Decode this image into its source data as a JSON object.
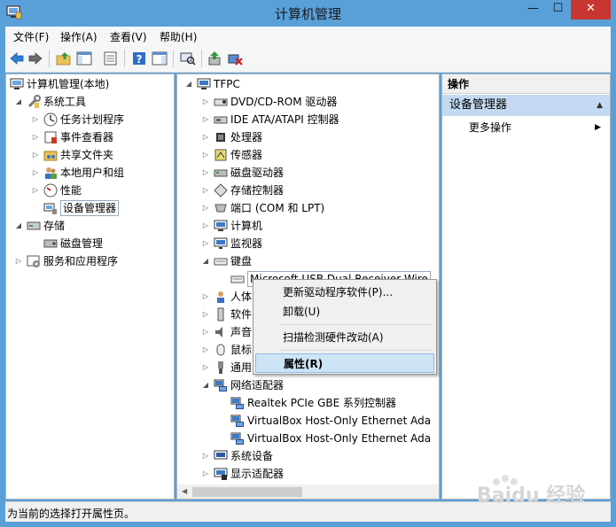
{
  "window": {
    "title": "计算机管理"
  },
  "titlebar_buttons": {
    "minimize": "—",
    "maximize": "☐",
    "close": "✕"
  },
  "menu": [
    {
      "label": "文件(F)"
    },
    {
      "label": "操作(A)"
    },
    {
      "label": "查看(V)"
    },
    {
      "label": "帮助(H)"
    }
  ],
  "toolbar": {
    "icons": [
      "back-icon",
      "forward-icon",
      "up-folder-icon",
      "show-hide-tree-icon",
      "properties-icon",
      "help-icon",
      "show-hide-action-pane-icon",
      "scan-hardware-icon",
      "update-driver-icon",
      "uninstall-device-icon"
    ]
  },
  "left_tree": [
    {
      "label": "计算机管理(本地)",
      "icon": "computer-management-icon",
      "level": 0,
      "arrow": ""
    },
    {
      "label": "系统工具",
      "icon": "system-tools-icon",
      "level": 1,
      "arrow": "expanded"
    },
    {
      "label": "任务计划程序",
      "icon": "task-scheduler-icon",
      "level": 2,
      "arrow": "collapsed"
    },
    {
      "label": "事件查看器",
      "icon": "event-viewer-icon",
      "level": 2,
      "arrow": "collapsed"
    },
    {
      "label": "共享文件夹",
      "icon": "shared-folders-icon",
      "level": 2,
      "arrow": "collapsed"
    },
    {
      "label": "本地用户和组",
      "icon": "local-users-icon",
      "level": 2,
      "arrow": "collapsed"
    },
    {
      "label": "性能",
      "icon": "performance-icon",
      "level": 2,
      "arrow": "collapsed"
    },
    {
      "label": "设备管理器",
      "icon": "device-manager-icon",
      "level": 2,
      "arrow": "",
      "selected": true
    },
    {
      "label": "存储",
      "icon": "storage-icon",
      "level": 1,
      "arrow": "expanded"
    },
    {
      "label": "磁盘管理",
      "icon": "disk-management-icon",
      "level": 2,
      "arrow": ""
    },
    {
      "label": "服务和应用程序",
      "icon": "services-icon",
      "level": 1,
      "arrow": "collapsed"
    }
  ],
  "device_tree": [
    {
      "label": "TFPC",
      "icon": "computer-icon",
      "level": 0,
      "arrow": "expanded"
    },
    {
      "label": "DVD/CD-ROM 驱动器",
      "icon": "dvd-drive-icon",
      "level": 1,
      "arrow": "collapsed"
    },
    {
      "label": "IDE ATA/ATAPI 控制器",
      "icon": "ide-controller-icon",
      "level": 1,
      "arrow": "collapsed"
    },
    {
      "label": "处理器",
      "icon": "processor-icon",
      "level": 1,
      "arrow": "collapsed"
    },
    {
      "label": "传感器",
      "icon": "sensor-icon",
      "level": 1,
      "arrow": "collapsed"
    },
    {
      "label": "磁盘驱动器",
      "icon": "disk-drive-icon",
      "level": 1,
      "arrow": "collapsed"
    },
    {
      "label": "存储控制器",
      "icon": "storage-controller-icon",
      "level": 1,
      "arrow": "collapsed"
    },
    {
      "label": "端口 (COM 和 LPT)",
      "icon": "port-icon",
      "level": 1,
      "arrow": "collapsed"
    },
    {
      "label": "计算机",
      "icon": "computer-icon",
      "level": 1,
      "arrow": "collapsed"
    },
    {
      "label": "监视器",
      "icon": "monitor-icon",
      "level": 1,
      "arrow": "collapsed"
    },
    {
      "label": "键盘",
      "icon": "keyboard-icon",
      "level": 1,
      "arrow": "expanded"
    },
    {
      "label": "Microsoft USB Dual Receiver Wire",
      "icon": "keyboard-icon",
      "level": 2,
      "arrow": "",
      "selected": true
    },
    {
      "label": "人体",
      "icon": "hid-icon",
      "level": 1,
      "arrow": "collapsed"
    },
    {
      "label": "软件",
      "icon": "software-device-icon",
      "level": 1,
      "arrow": "collapsed"
    },
    {
      "label": "声音",
      "icon": "sound-icon",
      "level": 1,
      "arrow": "collapsed"
    },
    {
      "label": "鼠标",
      "icon": "mouse-icon",
      "level": 1,
      "arrow": "collapsed"
    },
    {
      "label": "通用",
      "icon": "usb-icon",
      "level": 1,
      "arrow": "collapsed"
    },
    {
      "label": "网络适配器",
      "icon": "network-adapter-icon",
      "level": 1,
      "arrow": "expanded"
    },
    {
      "label": "Realtek PCIe GBE 系列控制器",
      "icon": "network-adapter-icon",
      "level": 2,
      "arrow": ""
    },
    {
      "label": "VirtualBox Host-Only Ethernet Ada",
      "icon": "network-adapter-icon",
      "level": 2,
      "arrow": ""
    },
    {
      "label": "VirtualBox Host-Only Ethernet Ada",
      "icon": "network-adapter-icon",
      "level": 2,
      "arrow": ""
    },
    {
      "label": "系统设备",
      "icon": "system-device-icon",
      "level": 1,
      "arrow": "collapsed"
    },
    {
      "label": "显示适配器",
      "icon": "display-adapter-icon",
      "level": 1,
      "arrow": "collapsed"
    }
  ],
  "context_menu": [
    {
      "label": "更新驱动程序软件(P)..."
    },
    {
      "label": "卸载(U)"
    },
    {
      "label": "扫描检测硬件改动(A)"
    },
    {
      "label": "属性(R)",
      "bold": true,
      "highlighted": true
    }
  ],
  "action_pane": {
    "header": "操作",
    "section": "设备管理器",
    "more_actions": "更多操作"
  },
  "status": "为当前的选择打开属性页。",
  "watermark": "Baidu 经验"
}
